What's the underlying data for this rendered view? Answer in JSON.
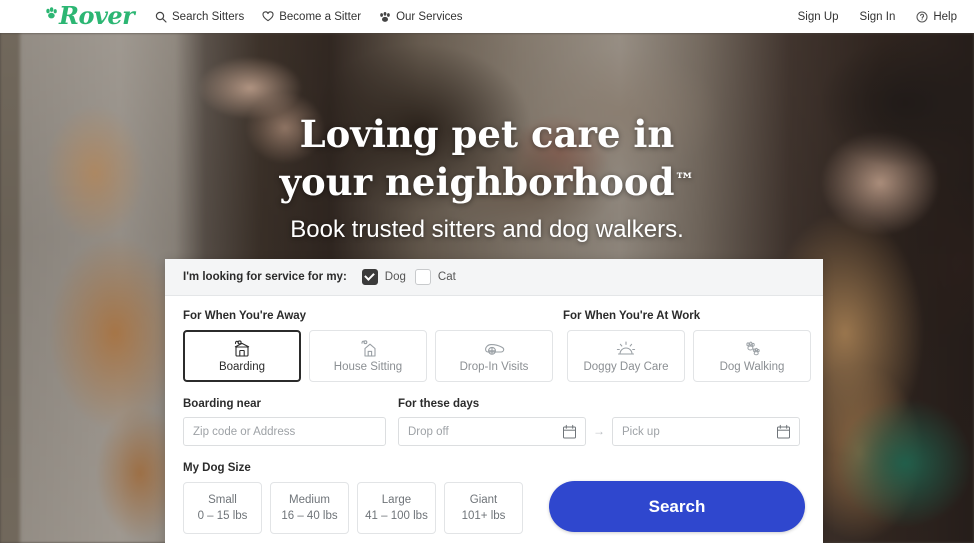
{
  "nav": {
    "logo_text": "Rover",
    "left_items": [
      {
        "icon": "search-icon",
        "label": "Search Sitters"
      },
      {
        "icon": "heart-icon",
        "label": "Become a Sitter"
      },
      {
        "icon": "paw-icon",
        "label": "Our Services"
      }
    ],
    "right_items": [
      {
        "icon": "",
        "label": "Sign Up"
      },
      {
        "icon": "",
        "label": "Sign In"
      },
      {
        "icon": "question-circle-icon",
        "label": "Help"
      }
    ]
  },
  "hero": {
    "title_line1": "Loving pet care in your",
    "title_line2": "neighborhood",
    "title_tm": "™",
    "subtitle": "Book trusted sitters and dog walkers."
  },
  "form": {
    "pet_prompt": "I'm looking for service for my:",
    "pets": [
      {
        "label": "Dog",
        "checked": true
      },
      {
        "label": "Cat",
        "checked": false
      }
    ],
    "group_away_label": "For When You're Away",
    "group_work_label": "For When You're At Work",
    "services_away": [
      {
        "label": "Boarding",
        "icon": "boarding-house-icon",
        "selected": true
      },
      {
        "label": "House Sitting",
        "icon": "house-sitting-icon",
        "selected": false
      },
      {
        "label": "Drop-In Visits",
        "icon": "drop-in-visits-icon",
        "selected": false
      }
    ],
    "services_work": [
      {
        "label": "Doggy Day Care",
        "icon": "sun-icon",
        "selected": false
      },
      {
        "label": "Dog Walking",
        "icon": "paw-prints-icon",
        "selected": false
      }
    ],
    "location_label": "Boarding near",
    "location_placeholder": "Zip code or Address",
    "location_value": "",
    "dates_label": "For these days",
    "dropoff_placeholder": "Drop off",
    "dropoff_value": "",
    "date_arrow": "→",
    "pickup_placeholder": "Pick up",
    "pickup_value": "",
    "size_label": "My Dog Size",
    "sizes": [
      {
        "name": "Small",
        "range": "0 – 15 lbs"
      },
      {
        "name": "Medium",
        "range": "16 – 40 lbs"
      },
      {
        "name": "Large",
        "range": "41 – 100 lbs"
      },
      {
        "name": "Giant",
        "range": "101+ lbs"
      }
    ],
    "search_label": "Search"
  },
  "colors": {
    "brand_green": "#2CB673",
    "search_blue": "#2F47CE",
    "selected_border": "#2B2B2B",
    "panel_header_bg": "#F4F5F6"
  }
}
